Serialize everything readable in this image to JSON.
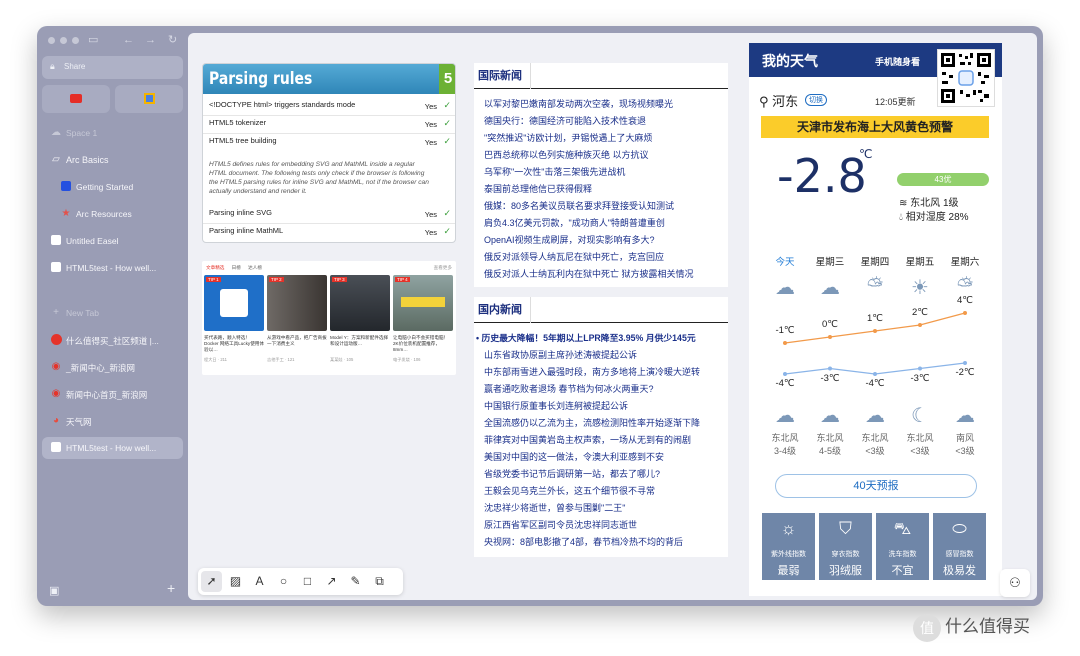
{
  "sidebar": {
    "share_label": "Share",
    "space_label": "Space 1",
    "folder_label": "Arc Basics",
    "items": [
      {
        "label": "Getting Started"
      },
      {
        "label": "Arc Resources"
      },
      {
        "label": "Untitled Easel"
      },
      {
        "label": "HTML5test - How well..."
      }
    ],
    "new_tab_label": "New Tab",
    "tabs": [
      {
        "label": "什么值得买_社区频道 |..."
      },
      {
        "label": "_新闻中心_新浪网"
      },
      {
        "label": "新闻中心首页_新浪网"
      },
      {
        "label": "天气网"
      },
      {
        "label": "HTML5test - How well..."
      }
    ],
    "add_label": "+"
  },
  "parsing": {
    "title": "Parsing rules",
    "score": "5",
    "rows": [
      {
        "label": "<!DOCTYPE html> triggers standards mode",
        "status": "Yes"
      },
      {
        "label": "HTML5 tokenizer",
        "status": "Yes"
      },
      {
        "label": "HTML5 tree building",
        "status": "Yes"
      }
    ],
    "note": "HTML5 defines rules for embedding SVG and MathML inside a regular HTML document. The following tests only check if the browser is following the HTML5 parsing rules for inline SVG and MathML, not if the browser can actually understand and render it.",
    "rows2": [
      {
        "label": "Parsing inline SVG",
        "status": "Yes"
      },
      {
        "label": "Parsing inline MathML",
        "status": "Yes"
      }
    ]
  },
  "zdm": {
    "tabs": [
      "文章精选",
      "日榜",
      "达人榜"
    ],
    "more": "查看更多",
    "cards": [
      {
        "tip": "TIP 1",
        "caption": "买代表路，顺入特选！Docker 网络工具Lucky使用体验以…",
        "meta": "程大日",
        "count": "211"
      },
      {
        "tip": "TIP 2",
        "caption": "从游戏中看产品，把广告商拔一下消费主义",
        "meta": "吉他手工",
        "count": "121"
      },
      {
        "tip": "TIP 3",
        "caption": "Model Y：方案和新配件选择和设计运动版…",
        "meta": "某某娃",
        "count": "105"
      },
      {
        "tip": "TIP 4",
        "caption": "让电脑小白不会买错电脑！2K价位装机配置推荐，8mm…",
        "meta": "电子发烧",
        "count": "106"
      }
    ]
  },
  "intl_news": {
    "heading": "国际新闻",
    "items": [
      "以军对黎巴嫩南部发动两次空袭，现场视频曝光",
      "德国央行：德国经济可能陷入技术性衰退",
      "\"突然推迟\"访欧计划，尹锡悦遇上了大麻烦",
      "巴西总统称以色列实施种族灭绝 以方抗议",
      "乌军称\"一次性\"击落三架俄先进战机",
      "泰国前总理他信已获得假释",
      "俄媒：80多名美议员联名要求拜登接受认知测试",
      "肩负4.3亿美元罚款，\"成功商人\"特朗普遭重创",
      "OpenAI视频生成刷屏，对现实影响有多大?",
      "俄反对派领导人纳瓦尼在狱中死亡，克宫回应",
      "俄反对派人士纳瓦利内在狱中死亡 狱方披露相关情况"
    ]
  },
  "domestic_news": {
    "heading": "国内新闻",
    "headline": "历史最大降幅！5年期以上LPR降至3.95% 月供少145元",
    "items": [
      "山东省政协原副主席孙述涛被提起公诉",
      "中东部雨雪进入最强时段，南方多地将上演冷暖大逆转",
      "赢者通吃败者退场 春节档为何冰火两重天?",
      "中国银行原董事长刘连舸被提起公诉",
      "全国流感仍以乙流为主，流感检测阳性率开始逐渐下降",
      "菲律宾对中国黄岩岛主权声索，一场从无到有的闹剧",
      "美国对中国的这一做法，令澳大利亚感到不安",
      "省级党委书记节后调研第一站，都去了哪儿?",
      "王毅会见乌克兰外长，这五个细节很不寻常",
      "沈忠祥少将逝世，曾参与围剿\"二王\"",
      "原江西省军区副司令员沈忠祥同志逝世",
      "央视网：8部电影撤了4部，春节档冷热不均的背后"
    ]
  },
  "weather": {
    "title": "我的天气",
    "mobile": "手机随身看",
    "location": "河东",
    "switch": "切换",
    "updated": "12:05更新",
    "warning": "天津市发布海上大风黄色预警",
    "temperature": "-2.8",
    "unit": "℃",
    "aqi": "43优",
    "wind": "东北风 1级",
    "humidity": "相对湿度 28%",
    "days": [
      {
        "name": "今天",
        "day_icon": "cloud-drizzle-icon",
        "high": "-1℃",
        "low": "-4℃",
        "night_icon": "cloud-drizzle-icon",
        "wind": "东北风",
        "level": "3-4级"
      },
      {
        "name": "星期三",
        "day_icon": "cloudy-icon",
        "high": "0℃",
        "low": "-3℃",
        "night_icon": "cloudy-icon",
        "wind": "东北风",
        "level": "4-5级"
      },
      {
        "name": "星期四",
        "day_icon": "partly-cloudy-icon",
        "high": "1℃",
        "low": "-4℃",
        "night_icon": "partly-cloudy-night-icon",
        "wind": "东北风",
        "level": "<3级"
      },
      {
        "name": "星期五",
        "day_icon": "sunny-icon",
        "high": "2℃",
        "low": "-3℃",
        "night_icon": "moon-icon",
        "wind": "东北风",
        "level": "<3级"
      },
      {
        "name": "星期六",
        "day_icon": "partly-cloudy-icon",
        "high": "4℃",
        "low": "-2℃",
        "night_icon": "partly-cloudy-night-icon",
        "wind": "南风",
        "level": "<3级"
      }
    ],
    "forecast_btn": "40天预报",
    "indices": [
      {
        "name": "紫外线指数",
        "value": "最弱",
        "icon": "sun-icon"
      },
      {
        "name": "穿衣指数",
        "value": "羽绒服",
        "icon": "coat-icon"
      },
      {
        "name": "洗车指数",
        "value": "不宜",
        "icon": "car-icon"
      },
      {
        "name": "感冒指数",
        "value": "极易发",
        "icon": "pill-icon"
      }
    ],
    "colors": {
      "high_line": "#f29a4a",
      "low_line": "#8ab4e8"
    }
  },
  "watermark": {
    "text": "什么值得买",
    "icon": "值"
  }
}
